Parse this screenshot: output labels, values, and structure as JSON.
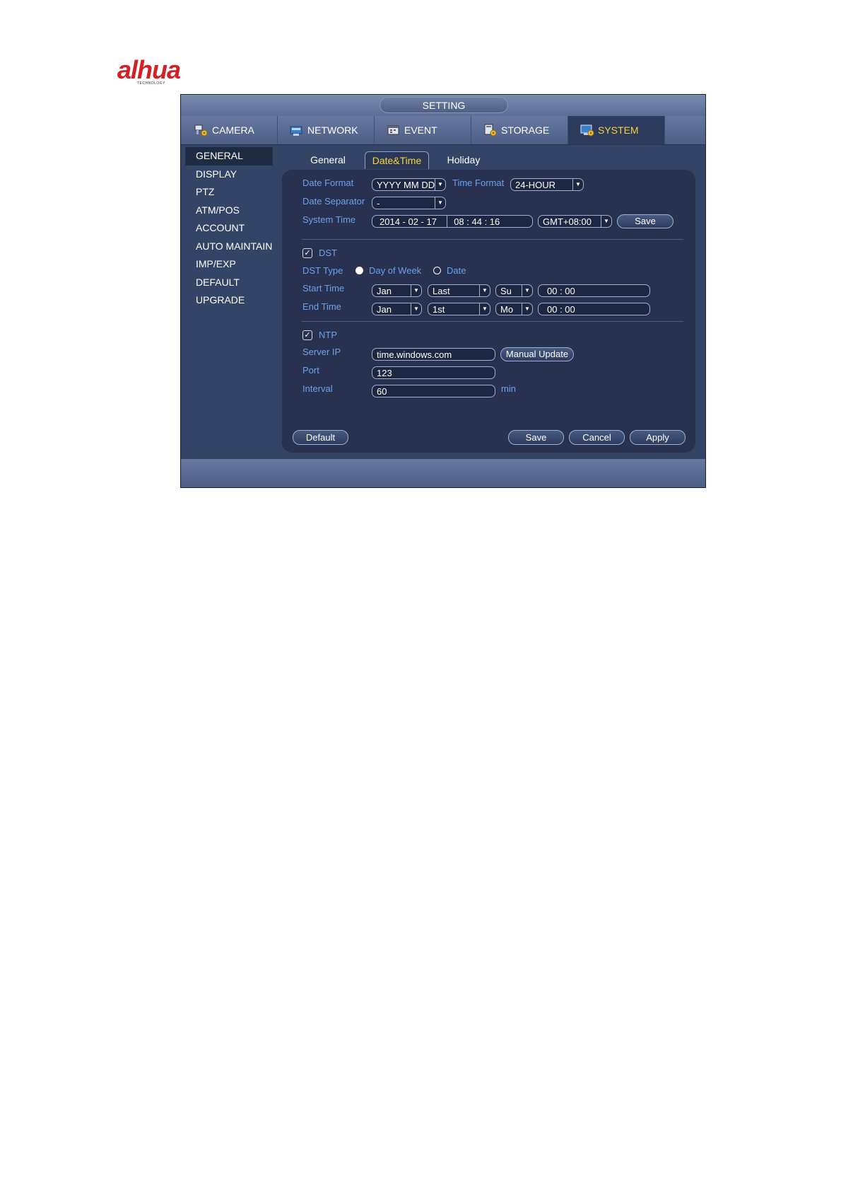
{
  "window": {
    "title": "SETTING"
  },
  "main_tabs": [
    {
      "label": "CAMERA",
      "icon": "camera-gear-icon"
    },
    {
      "label": "NETWORK",
      "icon": "network-icon"
    },
    {
      "label": "EVENT",
      "icon": "event-icon"
    },
    {
      "label": "STORAGE",
      "icon": "storage-icon"
    },
    {
      "label": "SYSTEM",
      "icon": "system-icon",
      "active": true
    }
  ],
  "sidebar": {
    "items": [
      "GENERAL",
      "DISPLAY",
      "PTZ",
      "ATM/POS",
      "ACCOUNT",
      "AUTO MAINTAIN",
      "IMP/EXP",
      "DEFAULT",
      "UPGRADE"
    ],
    "active": "GENERAL"
  },
  "sub_tabs": [
    "General",
    "Date&Time",
    "Holiday"
  ],
  "datetime": {
    "date_format_label": "Date Format",
    "date_format_value": "YYYY MM DD",
    "time_format_label": "Time Format",
    "time_format_value": "24-HOUR",
    "date_separator_label": "Date Separator",
    "date_separator_value": "-",
    "system_time_label": "System Time",
    "system_time_date": "2014 - 02 - 17",
    "system_time_clock": "08 :  44 :  16",
    "timezone_value": "GMT+08:00",
    "save_label": "Save"
  },
  "dst": {
    "label": "DST",
    "checked": true,
    "type_label": "DST Type",
    "opt_day_of_week": "Day of Week",
    "opt_date": "Date",
    "start_label": "Start Time",
    "start_month": "Jan",
    "start_week": "Last",
    "start_day": "Su",
    "start_time": "00  :   00",
    "end_label": "End Time",
    "end_month": "Jan",
    "end_week": "1st",
    "end_day": "Mo",
    "end_time": "00  :   00"
  },
  "ntp": {
    "label": "NTP",
    "checked": true,
    "server_label": "Server IP",
    "server_value": "time.windows.com",
    "manual_update_label": "Manual Update",
    "port_label": "Port",
    "port_value": "123",
    "interval_label": "Interval",
    "interval_value": "60",
    "interval_unit": "min"
  },
  "footer": {
    "default_label": "Default",
    "save_label": "Save",
    "cancel_label": "Cancel",
    "apply_label": "Apply"
  },
  "colors": {
    "window_bg": "#344466",
    "panel_bg": "#28314f",
    "label_blue": "#6fa1ea",
    "active_yellow": "#f5d33c"
  }
}
